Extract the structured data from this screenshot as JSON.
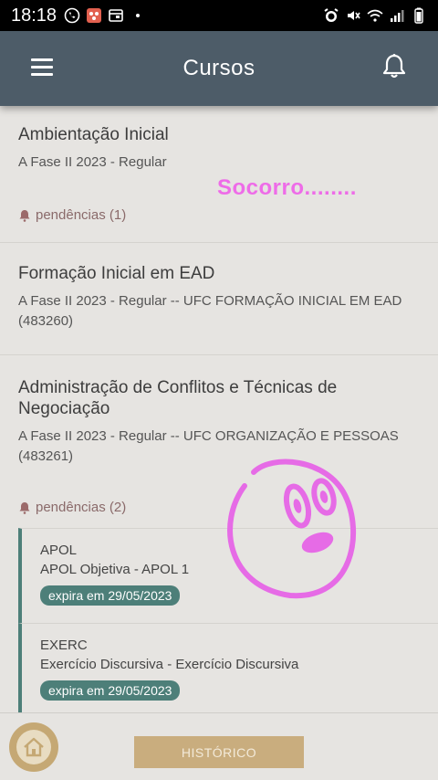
{
  "status_bar": {
    "time": "18:18",
    "left_icons": [
      "whatsapp-icon",
      "app-icon",
      "calendar-icon",
      "dot-icon"
    ],
    "right_icons": [
      "alarm-icon",
      "mute-icon",
      "wifi-icon",
      "signal-icon",
      "battery-icon"
    ]
  },
  "header": {
    "title": "Cursos"
  },
  "courses": [
    {
      "title": "Ambientação Inicial",
      "subtitle": "A Fase II 2023 - Regular",
      "pendencias": "pendências (1)"
    },
    {
      "title": "Formação Inicial em EAD",
      "subtitle": "A Fase II 2023 - Regular -- UFC FORMAÇÃO INICIAL EM EAD (483260)"
    },
    {
      "title": "Administração de Conflitos e Técnicas de Negociação",
      "subtitle": "A Fase II 2023 - Regular -- UFC ORGANIZAÇÃO E PESSOAS (483261)",
      "pendencias": "pendências (2)",
      "tasks": [
        {
          "code": "APOL",
          "desc": "APOL Objetiva - APOL 1",
          "badge": "expira em 29/05/2023"
        },
        {
          "code": "EXERC",
          "desc": "Exercício Discursiva - Exercício Discursiva",
          "badge": "expira em 29/05/2023"
        }
      ]
    }
  ],
  "overlay": {
    "text": "Socorro........"
  },
  "footer": {
    "history_label": "HISTÓRICO"
  },
  "colors": {
    "header_bg": "#4d5c68",
    "accent_teal": "#4d7f79",
    "gold": "#c9ad7e",
    "pend_text": "#8a6a6a",
    "overlay_pink": "#ee6ce8"
  }
}
